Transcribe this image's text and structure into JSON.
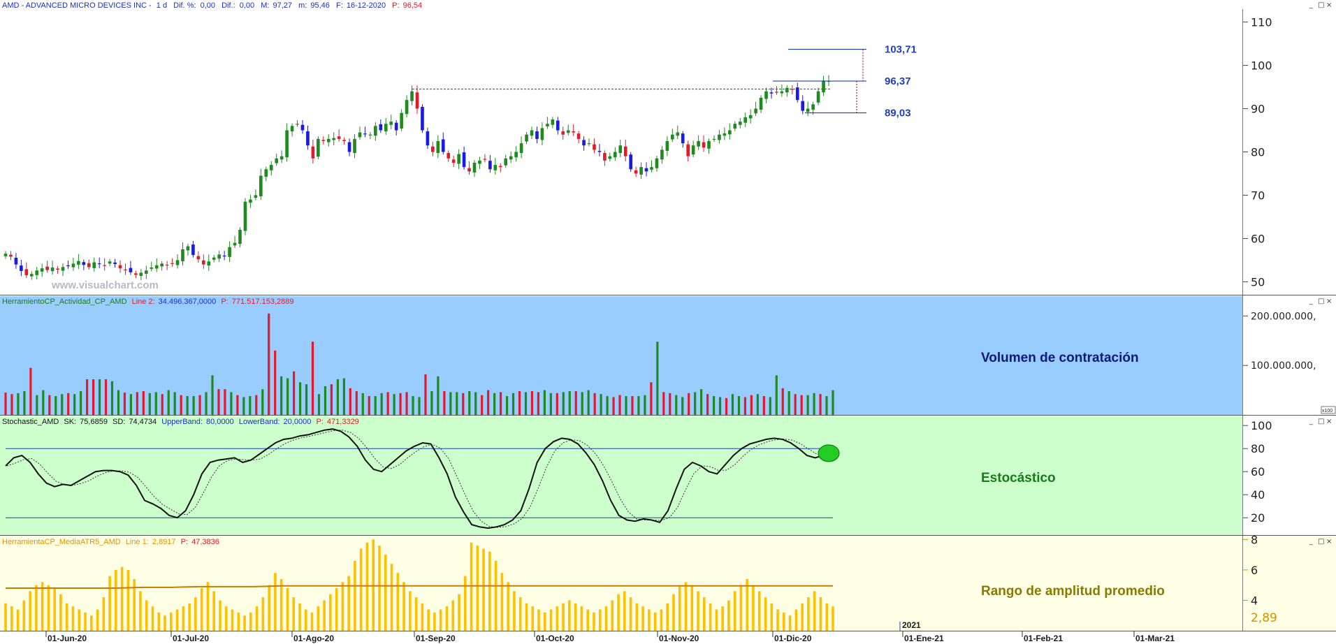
{
  "header": {
    "symbol": "AMD - ADVANCED MICRO DEVICES INC -",
    "period": "1 d",
    "dif_pct_label": "Dif. %:",
    "dif_pct": "0,00",
    "dif_label": "Dif.:",
    "dif": "0,00",
    "max_label": "M:",
    "max": "97,27",
    "min_label": "m:",
    "min": "95,46",
    "date_label": "F:",
    "date": "16-12-2020",
    "price_label": "P:",
    "price": "96,54"
  },
  "watermark": "www.visualchart.com",
  "window_controls": [
    "_",
    "□",
    "×"
  ],
  "colors": {
    "up_candle": "#1f8a1f",
    "down_candle": "#e01b2b",
    "blue_candle": "#1a1ae0",
    "level_line": "#1f3fbf",
    "volume_bg": "#99ccff",
    "stoch_bg": "#ccffcc",
    "atr_bg": "#ffffe6",
    "atr_bar": "#ffc000",
    "atr_avg": "#cc7a00"
  },
  "x_axis": {
    "ticks": [
      "01-Jun-20",
      "01-Jul-20",
      "01-Ago-20",
      "01-Sep-20",
      "01-Oct-20",
      "01-Nov-20",
      "01-Dic-20",
      "01-Ene-21",
      "01-Feb-21",
      "01-Mar-21"
    ],
    "year_marker": "2021"
  },
  "chart_data": [
    {
      "type": "candlestick",
      "title": "AMD - ADVANCED MICRO DEVICES INC",
      "ylim": [
        47,
        113
      ],
      "yticks": [
        "110",
        "100",
        "90",
        "80",
        "70",
        "60",
        "50"
      ],
      "closes": [
        56.5,
        55.8,
        54.0,
        52.5,
        51.5,
        51.8,
        52.6,
        53.1,
        52.7,
        53.3,
        52.8,
        53.4,
        53.6,
        54.2,
        54.8,
        53.9,
        53.4,
        54.5,
        54.1,
        53.8,
        54.7,
        54.1,
        53.1,
        52.8,
        52.2,
        51.6,
        52.1,
        52.6,
        53.3,
        53.8,
        54.2,
        53.9,
        54.1,
        55.0,
        57.5,
        58.2,
        56.2,
        55.2,
        54.0,
        54.7,
        55.6,
        56.3,
        56.0,
        58.0,
        59.0,
        62.0,
        68.5,
        69.0,
        70.0,
        74.5,
        76.0,
        77.0,
        78.5,
        79.0,
        85.0,
        86.0,
        86.5,
        85.0,
        81.5,
        78.5,
        83.0,
        82.5,
        83.0,
        83.2,
        83.0,
        82.5,
        80.0,
        83.0,
        84.5,
        84.2,
        84.0,
        86.0,
        85.0,
        86.5,
        87.0,
        85.0,
        89.0,
        92.0,
        94.0,
        90.0,
        85.0,
        81.5,
        80.0,
        82.5,
        80.0,
        78.5,
        77.5,
        79.5,
        76.5,
        75.5,
        77.5,
        78.0,
        78.2,
        76.0,
        77.0,
        76.5,
        78.5,
        79.0,
        80.0,
        82.0,
        84.0,
        85.0,
        83.0,
        85.5,
        86.5,
        87.5,
        85.0,
        84.0,
        85.0,
        84.5,
        83.0,
        81.5,
        82.0,
        80.5,
        80.0,
        78.0,
        79.0,
        80.0,
        81.5,
        79.0,
        76.0,
        75.0,
        76.5,
        75.5,
        76.5,
        78.5,
        80.5,
        82.5,
        84.0,
        84.5,
        82.0,
        79.0,
        81.5,
        82.5,
        81.0,
        82.5,
        83.0,
        84.0,
        84.3,
        85.0,
        86.5,
        87.0,
        88.0,
        88.5,
        90.0,
        92.5,
        94.0,
        93.5,
        93.8,
        94.0,
        94.8,
        94.5,
        92.0,
        89.5,
        90.0,
        91.0,
        94.0,
        96.5,
        96.4
      ],
      "volume": {
        "title": "HerramientoCP_Actividad_CP_AMD",
        "line_label": "Line 2:",
        "line_value": "34.496.367,0000",
        "p_label": "P:",
        "p_value": "771.517.153,2889",
        "panel_title": "Volumen de contratación",
        "yticks": [
          "200.000.000,",
          "100.000.000,"
        ],
        "ylim": [
          0,
          240000000
        ],
        "scale_badge": "x100",
        "values": [
          45,
          42,
          44,
          48,
          95,
          40,
          50,
          40,
          38,
          42,
          44,
          42,
          48,
          72,
          72,
          72,
          72,
          68,
          50,
          45,
          42,
          46,
          48,
          44,
          46,
          42,
          50,
          46,
          40,
          38,
          38,
          40,
          46,
          80,
          52,
          52,
          46,
          40,
          36,
          38,
          40,
          52,
          205,
          130,
          78,
          74,
          88,
          66,
          62,
          148,
          42,
          58,
          62,
          72,
          74,
          54,
          48,
          44,
          38,
          38,
          44,
          46,
          42,
          44,
          46,
          38,
          36,
          82,
          48,
          78,
          48,
          46,
          46,
          44,
          48,
          46,
          40,
          50,
          44,
          46,
          38,
          44,
          48,
          46,
          48,
          46,
          50,
          44,
          44,
          46,
          48,
          48,
          46,
          50,
          44,
          42,
          38,
          36,
          40,
          38,
          38,
          38,
          40,
          66,
          148,
          46,
          44,
          40,
          36,
          44,
          46,
          52,
          42,
          38,
          36,
          34,
          42,
          38,
          36,
          40,
          42,
          38,
          36,
          80,
          54,
          48,
          42,
          40,
          40,
          44,
          42,
          38,
          50
        ]
      }
    },
    {
      "type": "line",
      "title": "Stochastic_AMD",
      "sk_label": "SK:",
      "sk": "75,6859",
      "sd_label": "SD:",
      "sd": "74,4734",
      "upper_label": "UpperBand:",
      "upper": "80,0000",
      "lower_label": "LowerBand:",
      "lower": "20,0000",
      "p_label": "P:",
      "p_value": "471,3329",
      "panel_title": "Estocástico",
      "ylim": [
        5,
        108
      ],
      "yticks": [
        "100",
        "80",
        "60",
        "40",
        "20"
      ],
      "bands": [
        80,
        20
      ],
      "sk_values": [
        65,
        72,
        74,
        68,
        58,
        50,
        47,
        49,
        48,
        52,
        56,
        60,
        61,
        61,
        60,
        57,
        48,
        35,
        32,
        28,
        22,
        20,
        26,
        40,
        58,
        68,
        70,
        71,
        72,
        68,
        70,
        75,
        80,
        85,
        88,
        89,
        91,
        92,
        94,
        96,
        97,
        95,
        90,
        82,
        70,
        62,
        60,
        66,
        72,
        78,
        82,
        85,
        84,
        72,
        58,
        38,
        25,
        14,
        12,
        11,
        12,
        14,
        18,
        26,
        45,
        68,
        80,
        86,
        89,
        88,
        84,
        76,
        66,
        52,
        35,
        22,
        18,
        17,
        19,
        18,
        16,
        26,
        45,
        62,
        68,
        65,
        60,
        58,
        66,
        74,
        80,
        84,
        86,
        88,
        89,
        88,
        85,
        80,
        74,
        72,
        74,
        76
      ]
    },
    {
      "type": "bar",
      "title": "HerramientaCP_MediaATR5_AMD",
      "line_label": "Line 1:",
      "line_value": "2,8917",
      "p_label": "P:",
      "p_value": "47,3836",
      "panel_title": "Rango de amplitud promedio",
      "ylim": [
        2,
        8.2
      ],
      "yticks": [
        "8",
        "6",
        "4"
      ],
      "last_label": "2,89",
      "average": [
        4.8,
        4.8,
        4.8,
        4.8,
        4.8,
        4.85,
        4.85,
        4.9,
        4.9,
        4.9,
        4.95,
        4.95,
        4.95,
        4.95,
        4.95,
        4.95,
        4.95,
        4.95,
        4.95,
        4.95,
        4.95,
        4.95,
        4.95,
        4.95,
        4.95,
        4.95,
        4.95,
        4.95,
        4.95,
        4.95,
        4.95
      ],
      "values": [
        3.8,
        3.6,
        3.4,
        4.0,
        4.6,
        5.0,
        5.2,
        5.0,
        4.8,
        4.4,
        3.8,
        3.6,
        3.4,
        3.2,
        3.0,
        3.4,
        4.2,
        5.6,
        6.0,
        6.2,
        6.0,
        5.4,
        4.6,
        4.0,
        3.6,
        3.2,
        3.0,
        3.2,
        3.4,
        3.6,
        3.8,
        4.2,
        4.8,
        5.2,
        4.6,
        4.0,
        3.6,
        3.4,
        3.2,
        3.0,
        3.2,
        3.6,
        4.2,
        5.0,
        5.8,
        5.4,
        4.8,
        4.2,
        3.8,
        3.4,
        3.2,
        3.6,
        4.0,
        4.4,
        4.8,
        5.2,
        5.6,
        6.6,
        7.4,
        7.8,
        8.0,
        7.6,
        7.0,
        6.4,
        5.8,
        5.2,
        4.6,
        4.2,
        3.8,
        3.4,
        3.2,
        3.4,
        3.6,
        4.0,
        4.4,
        5.6,
        7.8,
        7.6,
        7.4,
        7.2,
        6.6,
        5.8,
        5.2,
        4.6,
        4.2,
        3.8,
        3.6,
        3.4,
        3.2,
        3.4,
        3.6,
        3.8,
        4.0,
        3.8,
        3.6,
        3.4,
        3.2,
        3.4,
        3.6,
        4.0,
        4.4,
        4.6,
        4.2,
        3.8,
        3.6,
        3.4,
        3.2,
        3.4,
        3.8,
        4.4,
        5.0,
        5.2,
        5.0,
        4.6,
        4.2,
        3.8,
        3.4,
        3.6,
        4.0,
        4.6,
        5.0,
        5.4,
        5.0,
        4.6,
        4.2,
        3.8,
        3.4,
        3.2,
        3.0,
        3.4,
        3.8,
        4.2,
        4.6,
        4.2,
        3.8,
        3.6
      ]
    }
  ],
  "annotations": {
    "levels": [
      "103,71",
      "96,37",
      "89,03"
    ],
    "level_values": [
      103.71,
      96.37,
      89.03
    ],
    "resistance": 94.5
  }
}
